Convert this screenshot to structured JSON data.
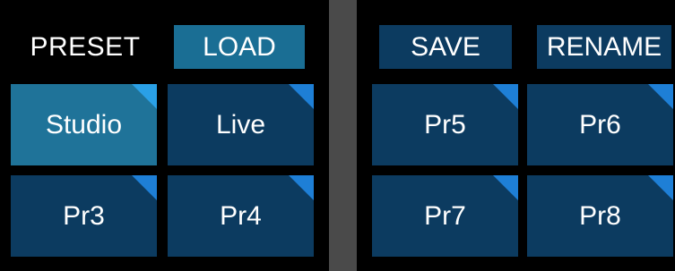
{
  "header": {
    "preset_label": "PRESET",
    "load_label": "LOAD",
    "save_label": "SAVE",
    "rename_label": "RENAME"
  },
  "presets_left": [
    {
      "label": "Studio",
      "selected": true
    },
    {
      "label": "Live",
      "selected": false
    },
    {
      "label": "Pr3",
      "selected": false
    },
    {
      "label": "Pr4",
      "selected": false
    }
  ],
  "presets_right": [
    {
      "label": "Pr5",
      "selected": false
    },
    {
      "label": "Pr6",
      "selected": false
    },
    {
      "label": "Pr7",
      "selected": false
    },
    {
      "label": "Pr8",
      "selected": false
    }
  ],
  "colors": {
    "background": "#000000",
    "divider": "#4a4a4a",
    "tile": "#0c3b60",
    "tile_selected": "#1f7399",
    "load_button": "#1a6e94",
    "corner_accent": "#1e7fd6"
  }
}
